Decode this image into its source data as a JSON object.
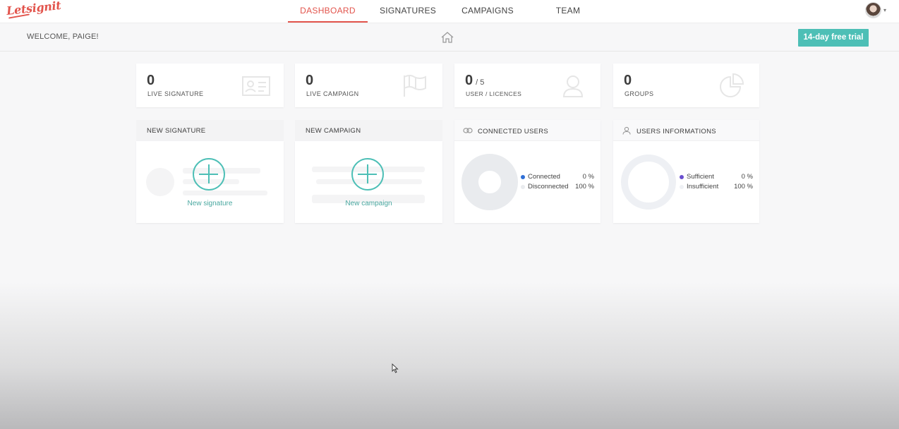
{
  "brand": {
    "logo_text": "Letsignit",
    "accent": "#e2544c",
    "teal": "#4dbfb6"
  },
  "nav": {
    "items": [
      {
        "label": "DASHBOARD",
        "active": true
      },
      {
        "label": "SIGNATURES",
        "active": false
      },
      {
        "label": "CAMPAIGNS",
        "active": false
      },
      {
        "label": "TEAM",
        "active": false
      }
    ],
    "user_icon": "user-avatar-icon",
    "user_caret_icon": "chevron-down-icon"
  },
  "subheader": {
    "welcome": "WELCOME, PAIGE!",
    "home_icon": "home-icon",
    "trial_button": "14-day free trial"
  },
  "stats": [
    {
      "value": "0",
      "sub": "",
      "label": "LIVE SIGNATURE",
      "icon": "id-card-icon"
    },
    {
      "value": "0",
      "sub": "",
      "label": "LIVE CAMPAIGN",
      "icon": "flag-icon"
    },
    {
      "value": "0",
      "sub": "/ 5",
      "label": "USER / LICENCES",
      "icon": "user-icon"
    },
    {
      "value": "0",
      "sub": "",
      "label": "GROUPS",
      "icon": "pie-chart-icon"
    }
  ],
  "actions": [
    {
      "title": "NEW SIGNATURE",
      "link": "New signature",
      "icon": "plus-circle-icon"
    },
    {
      "title": "NEW CAMPAIGN",
      "link": "New campaign",
      "icon": "plus-circle-icon"
    }
  ],
  "connected_users": {
    "title": "CONNECTED USERS",
    "icon": "link-icon",
    "segments": [
      {
        "label": "Connected",
        "value": "0 %",
        "fraction": 0.0,
        "color": "#2f6fd6"
      },
      {
        "label": "Disconnected",
        "value": "100 %",
        "fraction": 1.0,
        "color": "#e9ebee"
      }
    ]
  },
  "users_informations": {
    "title": "USERS INFORMATIONS",
    "icon": "user-outline-icon",
    "segments": [
      {
        "label": "Sufficient",
        "value": "0 %",
        "fraction": 0.0,
        "color": "#6a4fcf"
      },
      {
        "label": "Insufficient",
        "value": "100 %",
        "fraction": 1.0,
        "color": "#eef0f4"
      }
    ]
  }
}
